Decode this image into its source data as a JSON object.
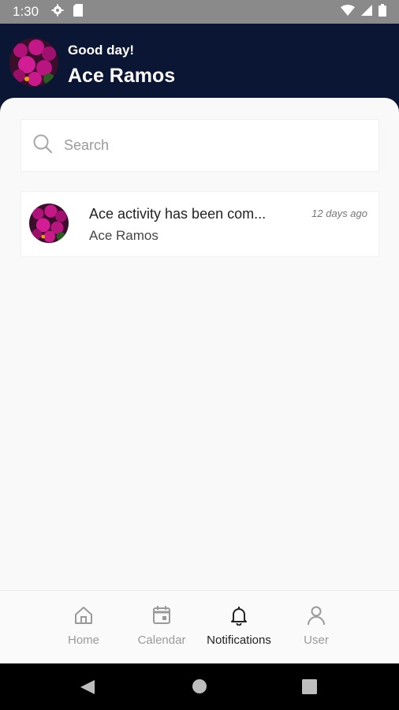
{
  "status_bar": {
    "time": "1:30"
  },
  "header": {
    "greeting": "Good day!",
    "name": "Ace Ramos"
  },
  "search": {
    "placeholder": "Search"
  },
  "notifications": [
    {
      "title": "Ace activity has been com...",
      "subtitle": "Ace Ramos",
      "time": "12 days ago"
    }
  ],
  "bottom_nav": {
    "items": [
      {
        "label": "Home",
        "icon": "home-icon",
        "active": false
      },
      {
        "label": "Calendar",
        "icon": "calendar-icon",
        "active": false
      },
      {
        "label": "Notifications",
        "icon": "bell-icon",
        "active": true
      },
      {
        "label": "User",
        "icon": "user-icon",
        "active": false
      }
    ]
  },
  "colors": {
    "header_bg": "#0a1633",
    "content_bg": "#f9f9f9",
    "active_nav": "#222222",
    "inactive_nav": "#9a9a9a"
  }
}
